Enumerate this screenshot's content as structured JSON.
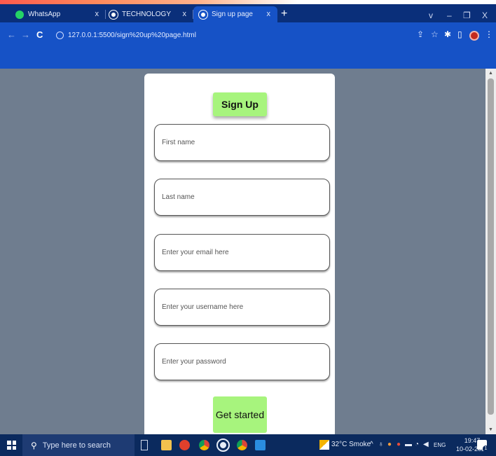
{
  "browser": {
    "tabs": [
      {
        "label": "WhatsApp",
        "close": "x",
        "icon": "whatsapp-icon",
        "color": "#25d366"
      },
      {
        "label": "TECHNOLOGY",
        "close": "x",
        "icon": "chrome-icon",
        "color": "#ffffff"
      },
      {
        "label": "Sign up page",
        "close": "x",
        "icon": "chrome-icon",
        "color": "#ffffff"
      }
    ],
    "new_tab": "+",
    "window_controls": {
      "dropdown": "v",
      "minimize": "–",
      "restore": "❐",
      "close": "X"
    },
    "url": "127.0.0.1:5500/sign%20up%20page.html",
    "nav": {
      "back": "←",
      "forward": "→",
      "reload": "C"
    },
    "toolbar_icons": {
      "share": "⇪",
      "star": "☆",
      "extensions": "✱",
      "sidebar": "▯",
      "menu": "⋮"
    }
  },
  "page": {
    "title": "Sign Up",
    "fields": [
      {
        "placeholder": "First name"
      },
      {
        "placeholder": "Last name"
      },
      {
        "placeholder": "Enter your email here"
      },
      {
        "placeholder": "Enter your username here"
      },
      {
        "placeholder": "Enter your password"
      }
    ],
    "submit_label": "Get started",
    "colors": {
      "background": "#6f7d8f",
      "button": "#a7f47d",
      "card": "#ffffff"
    }
  },
  "taskbar": {
    "search_placeholder": "Type here to search",
    "weather": "32°C Smoke",
    "tray_chevron": "^",
    "language": "ENG",
    "time": "19:47",
    "date": "10-02-2023",
    "notification_count": "1"
  }
}
